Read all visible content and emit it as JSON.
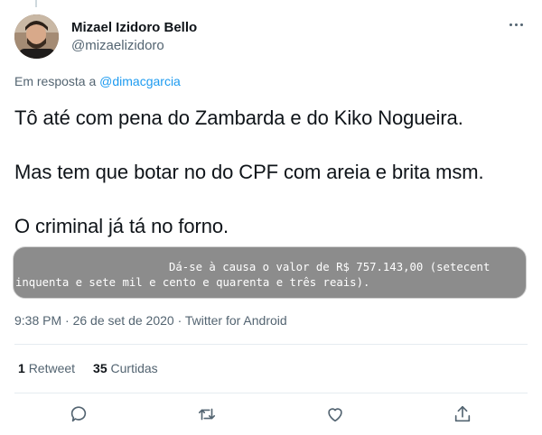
{
  "author": {
    "display_name": "Mizael Izidoro Bello",
    "handle": "@mizaelizidoro"
  },
  "reply": {
    "prefix": "Em resposta a",
    "mention": "@dimacgarcia"
  },
  "tweet": {
    "lines": [
      "Tô até com pena do Zambarda e do Kiko Nogueira.",
      "Mas tem que botar no do CPF com areia e brita msm.",
      "O criminal já tá no forno."
    ],
    "media": {
      "line1": "Dá-se à causa o valor de R$ 757.143,00 (setecent",
      "line2": "inquenta e sete mil e cento e quarenta e três reais)."
    },
    "meta": "9:38 PM · 26 de set de 2020 · Twitter for Android"
  },
  "stats": {
    "retweet_count": "1",
    "retweet_label": "Retweet",
    "like_count": "35",
    "like_label": "Curtidas"
  },
  "colors": {
    "accent": "#1d9bf0",
    "secondary_text": "#536471",
    "media_bg": "#8c8c8c"
  },
  "icons": [
    "more-icon",
    "reply-icon",
    "retweet-icon",
    "like-icon",
    "share-icon"
  ]
}
